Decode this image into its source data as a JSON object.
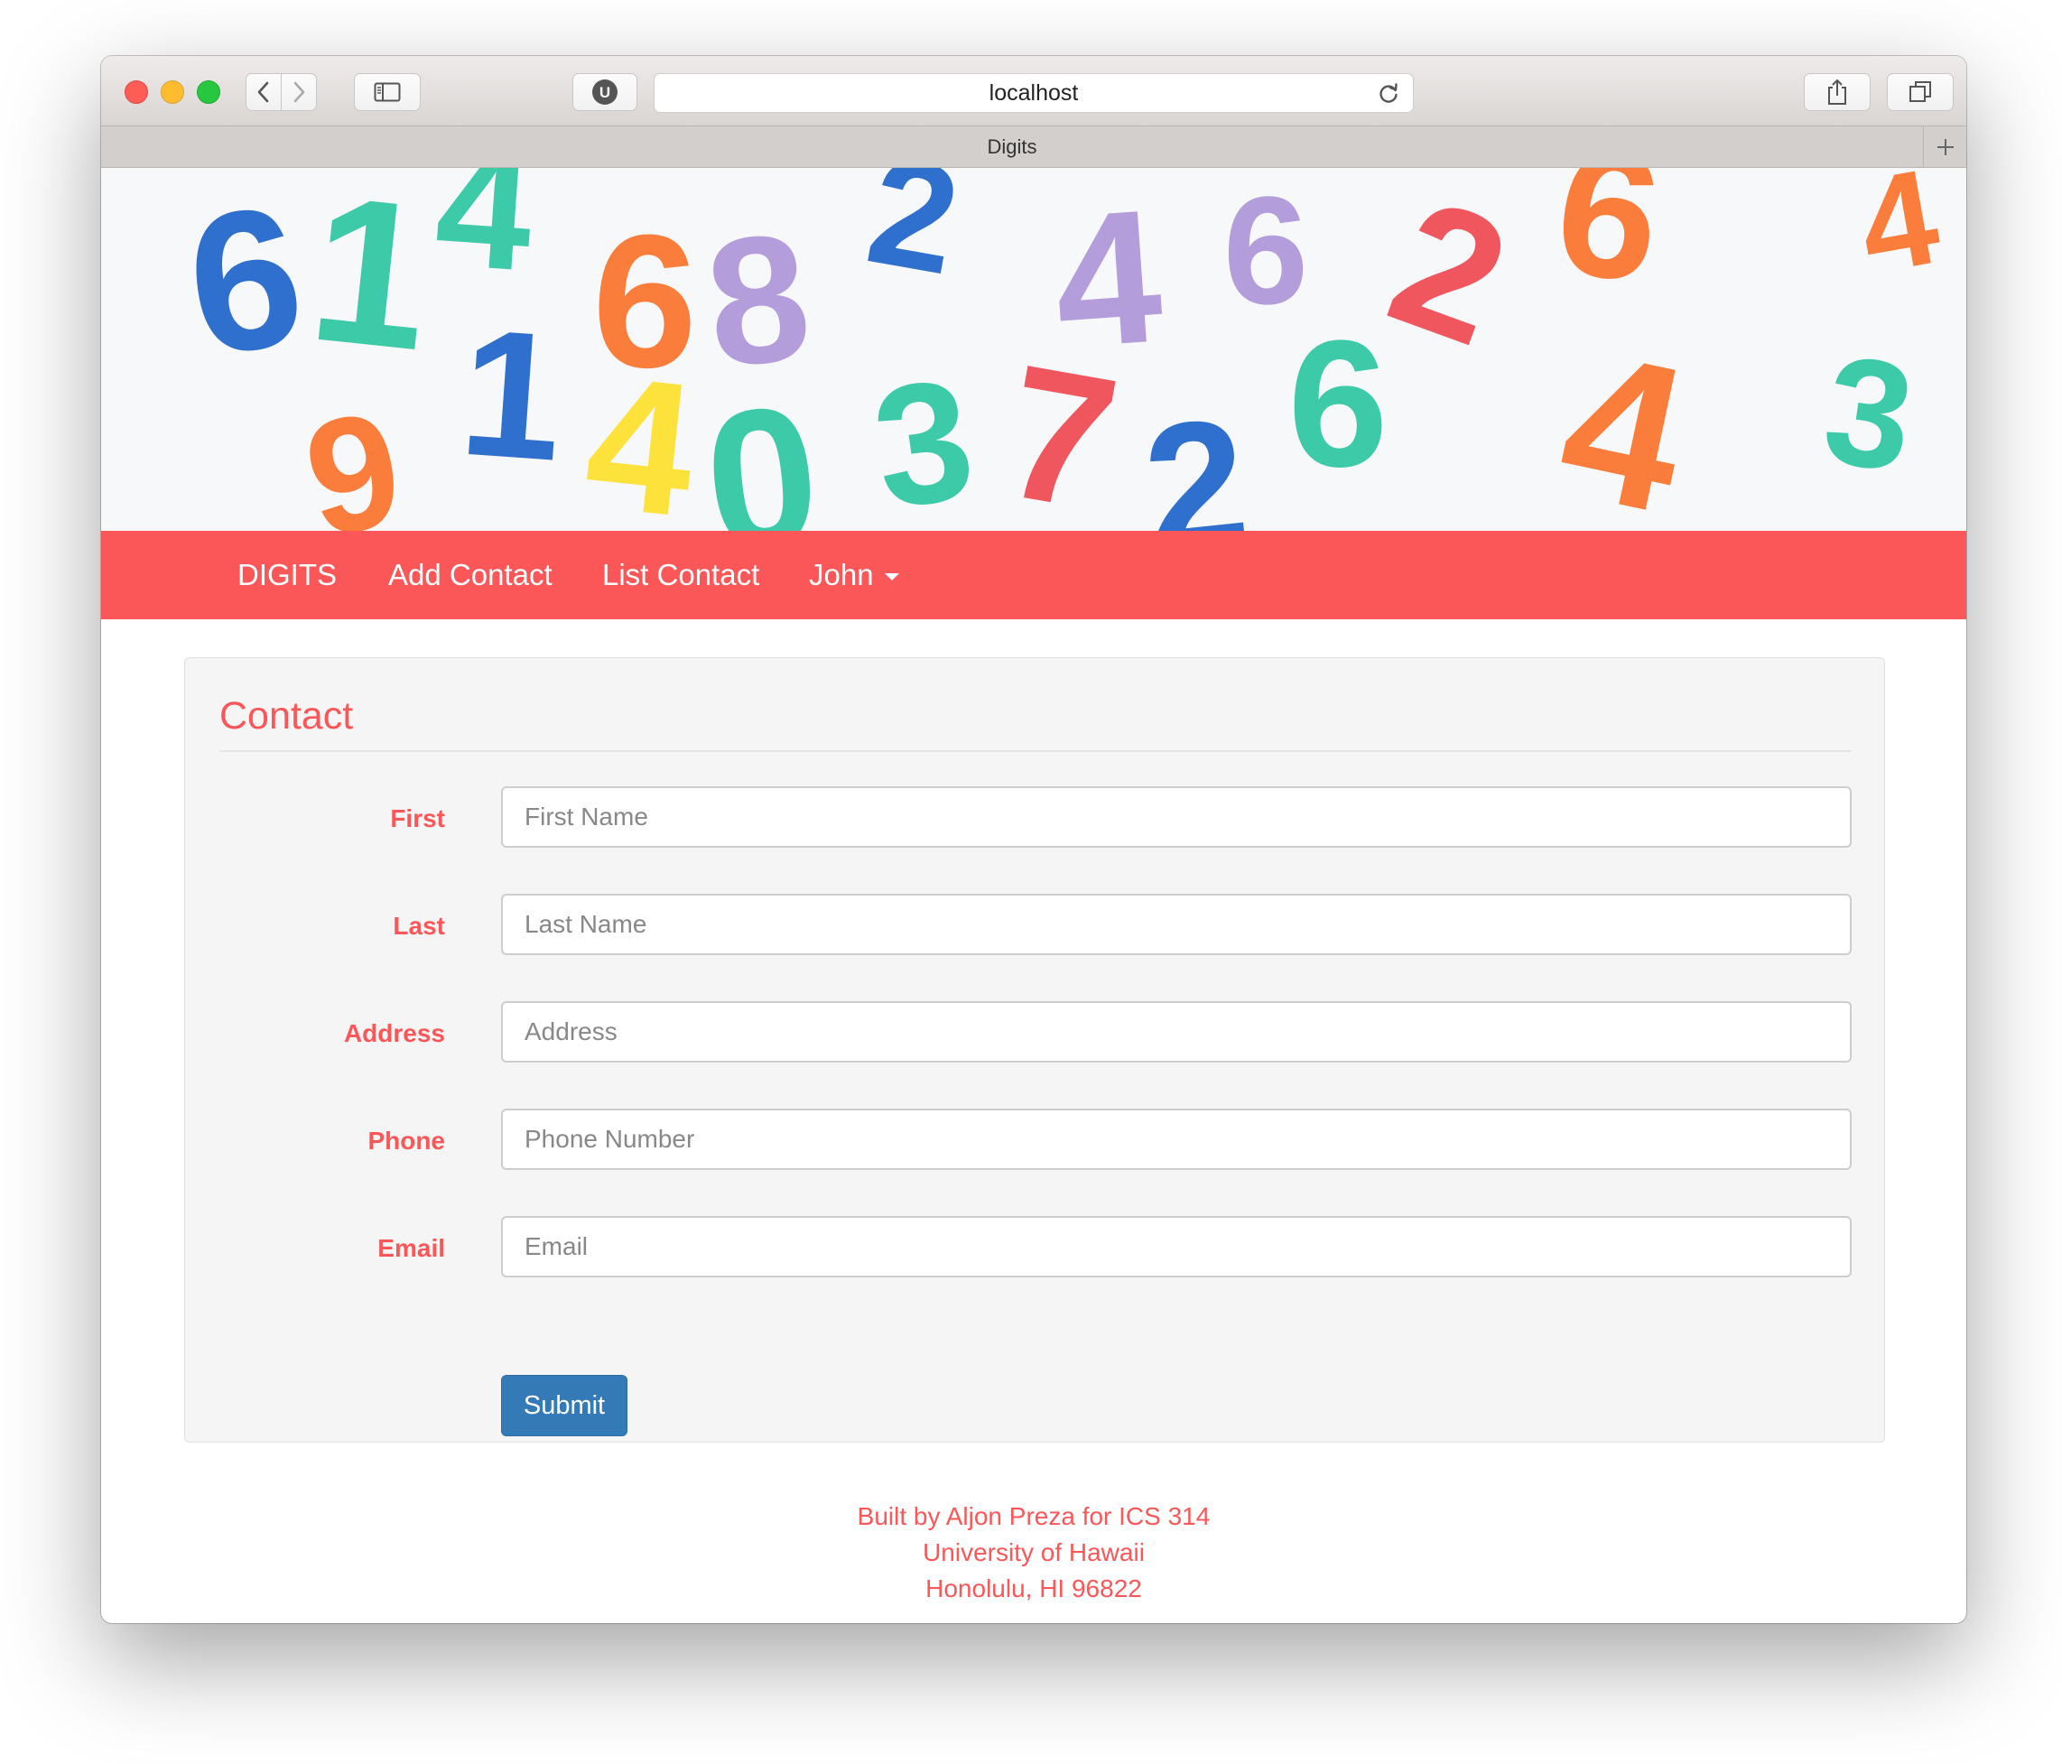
{
  "browser": {
    "url": "localhost",
    "tab_title": "Digits",
    "icons": {
      "back": "chevron-left-icon",
      "forward": "chevron-right-icon",
      "sidebar": "sidebar-icon",
      "extension": "ublock-icon",
      "reload": "reload-icon",
      "share": "share-icon",
      "tabs": "tabs-overview-icon",
      "new_tab": "plus-icon"
    }
  },
  "banner": {
    "description": "colorful foam numbers",
    "digits": [
      "6",
      "1",
      "4",
      "6",
      "8",
      "2",
      "4",
      "6",
      "2",
      "6",
      "1",
      "9",
      "4",
      "0",
      "3",
      "7",
      "2",
      "6",
      "4",
      "3",
      "4"
    ]
  },
  "navbar": {
    "brand": "DIGITS",
    "add_contact": "Add Contact",
    "list_contact": "List Contact",
    "user": "John",
    "color": "#fb5658"
  },
  "form": {
    "title": "Contact",
    "fields": [
      {
        "label": "First",
        "placeholder": "First Name",
        "value": ""
      },
      {
        "label": "Last",
        "placeholder": "Last Name",
        "value": ""
      },
      {
        "label": "Address",
        "placeholder": "Address",
        "value": ""
      },
      {
        "label": "Phone",
        "placeholder": "Phone Number",
        "value": ""
      },
      {
        "label": "Email",
        "placeholder": "Email",
        "value": ""
      }
    ],
    "submit": "Submit",
    "submit_color": "#337ab7"
  },
  "footer": {
    "lines": [
      "Built by Aljon Preza for ICS 314",
      "University of Hawaii",
      "Honolulu, HI 96822"
    ]
  }
}
